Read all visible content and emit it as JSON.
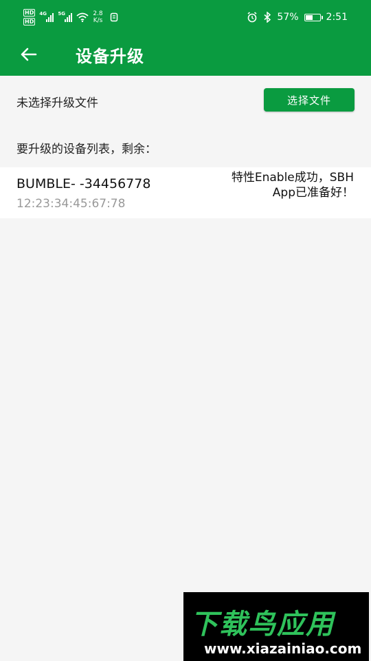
{
  "status_bar": {
    "hd1": "HD",
    "hd2": "HD",
    "sig1_tag": "4G",
    "sig2_tag": "5G",
    "speed_value": "2.8",
    "speed_unit": "K/s",
    "battery_percent": "57%",
    "battery_level": 0.57,
    "time": "2:51"
  },
  "app_bar": {
    "title": "设备升级"
  },
  "file_section": {
    "status_text": "未选择升级文件",
    "choose_button": "选择文件"
  },
  "device_list": {
    "label": "要升级的设备列表，剩余：",
    "items": [
      {
        "name": "BUMBLE- -34456778",
        "mac": "12:23:34:45:67:78",
        "status": "特性Enable成功，SBH App已准备好！"
      }
    ]
  },
  "watermark": {
    "logo": "下载鸟应用",
    "url": "www.xiazainiao.com"
  },
  "colors": {
    "brand_green": "#0a9b40",
    "background": "#f5f5f5"
  }
}
